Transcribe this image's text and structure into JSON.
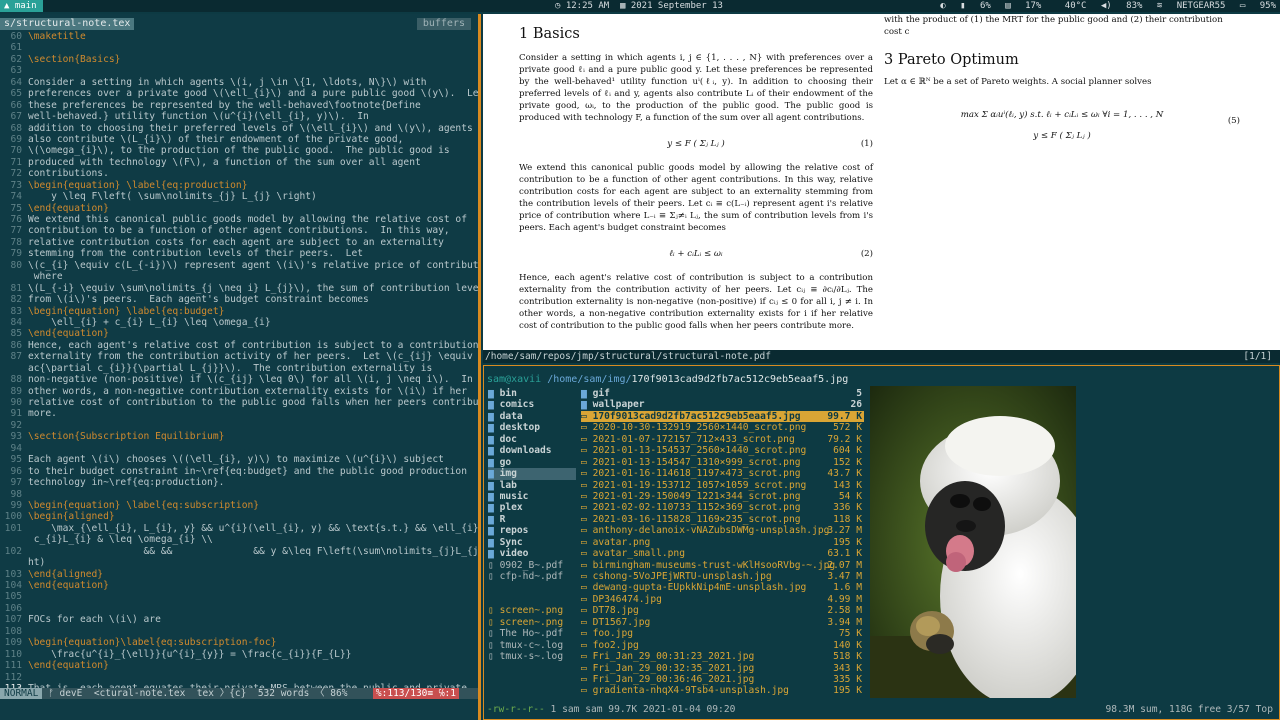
{
  "topbar": {
    "workspace": "main",
    "clock": "12:25 AM",
    "date": "2021 September 13",
    "status": [
      "6%",
      "17%",
      "40°C",
      "83%",
      "NETGEAR55",
      "95%"
    ]
  },
  "editor": {
    "filename": "s/structural-note.tex",
    "buffers_label": "buffers",
    "lines": [
      {
        "n": "60",
        "t": "\\maketitle"
      },
      {
        "n": "61",
        "t": ""
      },
      {
        "n": "62",
        "t": "\\section{Basics}"
      },
      {
        "n": "63",
        "t": ""
      },
      {
        "n": "64",
        "t": "Consider a setting in which agents \\(i, j \\in \\{1, \\ldots, N\\}\\) with"
      },
      {
        "n": "65",
        "t": "preferences over a private good \\(\\ell_{i}\\) and a pure public good \\(y\\).  Let"
      },
      {
        "n": "66",
        "t": "these preferences be represented by the well-behaved\\footnote{Define"
      },
      {
        "n": "67",
        "t": "well-behaved.} utility function \\(u^{i}(\\ell_{i}, y)\\).  In"
      },
      {
        "n": "68",
        "t": "addition to choosing their preferred levels of \\(\\ell_{i}\\) and \\(y\\), agents"
      },
      {
        "n": "69",
        "t": "also contribute \\(L_{i}\\) of their endowment of the private good,"
      },
      {
        "n": "70",
        "t": "\\(\\omega_{i}\\), to the production of the public good.  The public good is"
      },
      {
        "n": "71",
        "t": "produced with technology \\(F\\), a function of the sum over all agent"
      },
      {
        "n": "72",
        "t": "contributions."
      },
      {
        "n": "73",
        "t": "\\begin{equation} \\label{eq:production}"
      },
      {
        "n": "74",
        "t": "    y \\leq F\\left( \\sum\\nolimits_{j} L_{j} \\right)"
      },
      {
        "n": "75",
        "t": "\\end{equation}"
      },
      {
        "n": "76",
        "t": "We extend this canonical public goods model by allowing the relative cost of"
      },
      {
        "n": "77",
        "t": "contribution to be a function of other agent contributions.  In this way,"
      },
      {
        "n": "78",
        "t": "relative contribution costs for each agent are subject to an externality"
      },
      {
        "n": "79",
        "t": "stemming from the contribution levels of their peers.  Let"
      },
      {
        "n": "80",
        "t": "\\(c_{i} \\equiv c(L_{-i})\\) represent agent \\(i\\)'s relative price of contribution"
      },
      {
        "n": "",
        "t": " where"
      },
      {
        "n": "81",
        "t": "\\(L_{-i} \\equiv \\sum\\nolimits_{j \\neq i} L_{j}\\), the sum of contribution levels"
      },
      {
        "n": "82",
        "t": "from \\(i\\)'s peers.  Each agent's budget constraint becomes"
      },
      {
        "n": "83",
        "t": "\\begin{equation} \\label{eq:budget}"
      },
      {
        "n": "84",
        "t": "    \\ell_{i} + c_{i} L_{i} \\leq \\omega_{i}"
      },
      {
        "n": "85",
        "t": "\\end{equation}"
      },
      {
        "n": "86",
        "t": "Hence, each agent's relative cost of contribution is subject to a contribution"
      },
      {
        "n": "87",
        "t": "externality from the contribution activity of her peers.  Let \\(c_{ij} \\equiv \\fr"
      },
      {
        "n": "",
        "t": "ac{\\partial c_{i}}{\\partial L_{j}}\\).  The contribution externality is"
      },
      {
        "n": "88",
        "t": "non-negative (non-positive) if \\(c_{ij} \\leq 0\\) for all \\(i, j \\neq i\\).  In"
      },
      {
        "n": "89",
        "t": "other words, a non-negative contribution externality exists for \\(i\\) if her"
      },
      {
        "n": "90",
        "t": "relative cost of contribution to the public good falls when her peers contribute"
      },
      {
        "n": "91",
        "t": "more."
      },
      {
        "n": "92",
        "t": ""
      },
      {
        "n": "93",
        "t": "\\section{Subscription Equilibrium}"
      },
      {
        "n": "94",
        "t": ""
      },
      {
        "n": "95",
        "t": "Each agent \\(i\\) chooses \\((\\ell_{i}, y)\\) to maximize \\(u^{i}\\) subject"
      },
      {
        "n": "96",
        "t": "to their budget constraint in~\\ref{eq:budget} and the public good production"
      },
      {
        "n": "97",
        "t": "technology in~\\ref{eq:production}."
      },
      {
        "n": "98",
        "t": ""
      },
      {
        "n": "99",
        "t": "\\begin{equation} \\label{eq:subscription}"
      },
      {
        "n": "100",
        "t": "\\begin{aligned}"
      },
      {
        "n": "101",
        "t": "    \\max_{\\ell_{i}, L_{i}, y} && u^{i}(\\ell_{i}, y) && \\text{s.t.} && \\ell_{i} +"
      },
      {
        "n": "",
        "t": " c_{i}L_{i} & \\leq \\omega_{i} \\\\"
      },
      {
        "n": "102",
        "t": "                    && &&              && y &\\leq F\\left(\\sum\\nolimits_{j}L_{j}\\rig"
      },
      {
        "n": "",
        "t": "ht)"
      },
      {
        "n": "103",
        "t": "\\end{aligned}"
      },
      {
        "n": "104",
        "t": "\\end{equation}"
      },
      {
        "n": "105",
        "t": ""
      },
      {
        "n": "106",
        "t": ""
      },
      {
        "n": "107",
        "t": "FOCs for each \\(i\\) are"
      },
      {
        "n": "108",
        "t": ""
      },
      {
        "n": "109",
        "t": "\\begin{equation}\\label{eq:subscription-foc}"
      },
      {
        "n": "110",
        "t": "    \\frac{u^{i}_{\\ell}}{u^{i}_{y}} = \\frac{c_{i}}{F_{L}}"
      },
      {
        "n": "111",
        "t": "\\end{equation}"
      },
      {
        "n": "112",
        "t": ""
      },
      {
        "n": "113",
        "t": "That is, each agent equates their private MRS between the public and private"
      }
    ],
    "status": {
      "mode": "NORMAL",
      "branch": "devE",
      "file": "<ctural-note.tex",
      "ft": "tex",
      "ctx": "{c}",
      "words": "532 words",
      "pct": "86%",
      "pos": "%:113/130≡ ℅:1"
    }
  },
  "pdf": {
    "top_cut": "with the product of (1) the MRT for the public good and (2) their contribution cost c",
    "s1_title": "1   Basics",
    "s1_p1": "Consider a setting in which agents i, j ∈ {1, . . . , N} with preferences over a private good ℓᵢ and a pure public good y. Let these preferences be represented by the well-behaved¹ utility function uⁱ(ℓᵢ, y). In addition to choosing their preferred levels of ℓᵢ and y, agents also contribute Lᵢ of their endowment of the private good, ωᵢ, to the production of the public good. The public good is produced with technology F, a function of the sum over all agent contributions.",
    "eq1": "y ≤ F ( Σⱼ Lⱼ )",
    "eq1n": "(1)",
    "s1_p2": "We extend this canonical public goods model by allowing the relative cost of contribution to be a function of other agent contributions. In this way, relative contribution costs for each agent are subject to an externality stemming from the contribution levels of their peers. Let cᵢ ≡ c(L₋ᵢ) represent agent i's relative price of contribution where L₋ᵢ ≡ Σⱼ≠ᵢ Lⱼ, the sum of contribution levels from i's peers. Each agent's budget constraint becomes",
    "eq2": "ℓᵢ + cᵢLᵢ ≤ ωᵢ",
    "eq2n": "(2)",
    "s1_p3": "Hence, each agent's relative cost of contribution is subject to a contribution externality from the contribution activity of her peers. Let cᵢⱼ ≡ ∂cᵢ/∂Lⱼ. The contribution externality is non-negative (non-positive) if cᵢⱼ ≤ 0 for all i, j ≠ i. In other words, a non-negative contribution externality exists for i if her relative cost of contribution to the public good falls when her peers contribute more.",
    "s3_title": "3   Pareto Optimum",
    "s3_p1": "Let α ∈ ℝᴺ be a set of Pareto weights. A social planner solves",
    "eq5a": "max   Σ αᵢuⁱ(ℓᵢ, y)    s.t.   ℓᵢ + cᵢLᵢ ≤ ωᵢ   ∀i = 1, . . . , N",
    "eq5b": "y ≤ F ( Σⱼ Lⱼ )",
    "eq5n": "(5)",
    "status_path": "/home/sam/repos/jmp/structural/structural-note.pdf",
    "status_page": "[1/1]"
  },
  "fm": {
    "user": "sam@xavii",
    "cwd": "/home/sam/img/",
    "current": "170f9013cad9d2fb7ac512c9eb5eaaf5.jpg",
    "left": [
      {
        "name": "bin",
        "dir": true
      },
      {
        "name": "comics",
        "dir": true
      },
      {
        "name": "data",
        "dir": true
      },
      {
        "name": "desktop",
        "dir": true
      },
      {
        "name": "doc",
        "dir": true
      },
      {
        "name": "downloads",
        "dir": true
      },
      {
        "name": "go",
        "dir": true
      },
      {
        "name": "img",
        "dir": true,
        "sel": true
      },
      {
        "name": "lab",
        "dir": true
      },
      {
        "name": "music",
        "dir": true
      },
      {
        "name": "plex",
        "dir": true
      },
      {
        "name": "R",
        "dir": true
      },
      {
        "name": "repos",
        "dir": true
      },
      {
        "name": "Sync",
        "dir": true
      },
      {
        "name": "video",
        "dir": true
      },
      {
        "name": "0902_B~.pdf",
        "dir": false
      },
      {
        "name": "cfp-hd~.pdf",
        "dir": false
      },
      {
        "name": "",
        "dir": false
      },
      {
        "name": "",
        "dir": false
      },
      {
        "name": "screen~.png",
        "dir": false,
        "y": true
      },
      {
        "name": "screen~.png",
        "dir": false,
        "y": true
      },
      {
        "name": "The Ho~.pdf",
        "dir": false
      },
      {
        "name": "tmux-c~.log",
        "dir": false
      },
      {
        "name": "tmux-s~.log",
        "dir": false
      }
    ],
    "files": [
      {
        "name": "gif",
        "size": "5",
        "dir": true
      },
      {
        "name": "wallpaper",
        "size": "26",
        "dir": true
      },
      {
        "name": "170f9013cad9d2fb7ac512c9eb5eaaf5.jpg",
        "size": "99.7 K",
        "sel": true
      },
      {
        "name": "2020-10-30-132919_2560×1440_scrot.png",
        "size": "572 K"
      },
      {
        "name": "2021-01-07-172157_712×433_scrot.png",
        "size": "79.2 K"
      },
      {
        "name": "2021-01-13-154537_2560×1440_scrot.png",
        "size": "604 K"
      },
      {
        "name": "2021-01-13-154547_1310×999_scrot.png",
        "size": "152 K"
      },
      {
        "name": "2021-01-16-114618_1197×473_scrot.png",
        "size": "43.7 K"
      },
      {
        "name": "2021-01-19-153712_1057×1059_scrot.png",
        "size": "143 K"
      },
      {
        "name": "2021-01-29-150049_1221×344_scrot.png",
        "size": "54 K"
      },
      {
        "name": "2021-02-02-110733_1152×369_scrot.png",
        "size": "336 K"
      },
      {
        "name": "2021-03-16-115828_1169×235_scrot.png",
        "size": "118 K"
      },
      {
        "name": "anthony-delanoix-vNAZubsDWMg-unsplash.jpg",
        "size": "3.27 M"
      },
      {
        "name": "avatar.png",
        "size": "195 K"
      },
      {
        "name": "avatar_small.png",
        "size": "63.1 K"
      },
      {
        "name": "birmingham-museums-trust-wKlHsooRVbg-~.jpg",
        "size": "2.07 M"
      },
      {
        "name": "cshong-5VoJPEjWRTU-unsplash.jpg",
        "size": "3.47 M"
      },
      {
        "name": "dewang-gupta-EUpkkNip4mE-unsplash.jpg",
        "size": "1.6 M"
      },
      {
        "name": "DP346474.jpg",
        "size": "4.99 M"
      },
      {
        "name": "DT78.jpg",
        "size": "2.58 M"
      },
      {
        "name": "DT1567.jpg",
        "size": "3.94 M"
      },
      {
        "name": "foo.jpg",
        "size": "75 K"
      },
      {
        "name": "foo2.jpg",
        "size": "140 K"
      },
      {
        "name": "Fri_Jan_29_00:31:23_2021.jpg",
        "size": "518 K"
      },
      {
        "name": "Fri_Jan_29_00:32:35_2021.jpg",
        "size": "343 K"
      },
      {
        "name": "Fri_Jan_29_00:36:46_2021.jpg",
        "size": "335 K"
      },
      {
        "name": "gradienta-nhqX4-9Tsb4-unsplash.jpg",
        "size": "195 K"
      }
    ],
    "footer_perm": "-rw-r--r--",
    "footer_info": " 1 sam sam 99.7K 2021-01-04 09:20",
    "footer_right": "98.3M sum, 118G free  3/57  Top"
  }
}
